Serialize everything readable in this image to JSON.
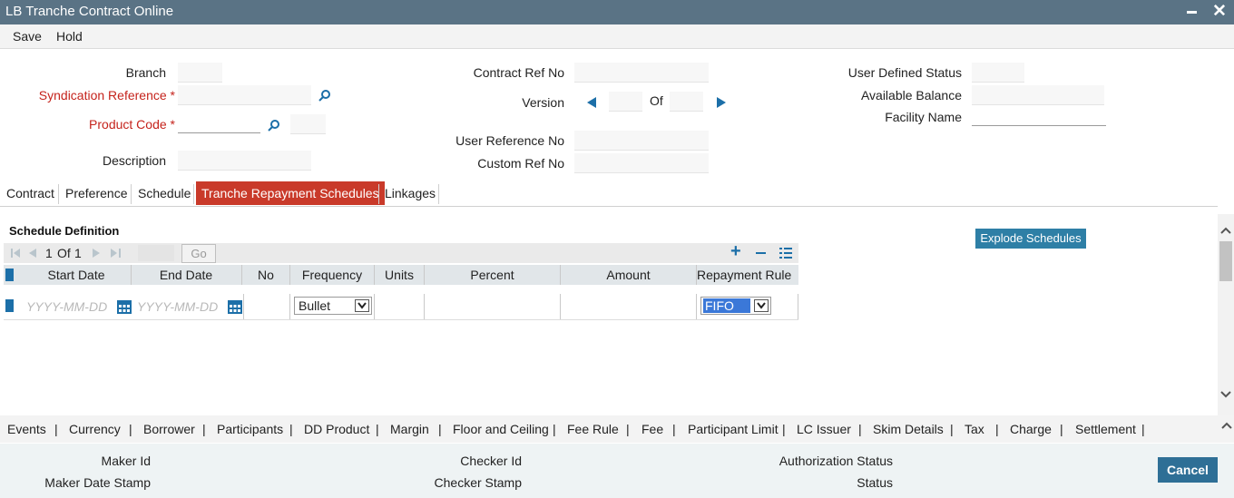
{
  "window": {
    "title": "LB Tranche Contract Online"
  },
  "menu": {
    "save": "Save",
    "hold": "Hold"
  },
  "form": {
    "branch_label": "Branch",
    "syndication_reference_label": "Syndication Reference",
    "product_code_label": "Product Code",
    "description_label": "Description",
    "required_mark": "*",
    "contract_ref_no_label": "Contract Ref No",
    "version_label": "Version",
    "of_label": "Of",
    "user_reference_no_label": "User Reference No",
    "custom_ref_no_label": "Custom Ref No",
    "user_defined_status_label": "User Defined Status",
    "available_balance_label": "Available Balance",
    "facility_name_label": "Facility Name"
  },
  "tabs": [
    "Contract",
    "Preference",
    "Schedule",
    "Tranche Repayment Schedules",
    "Linkages"
  ],
  "active_tab": "Tranche Repayment Schedules",
  "schedule": {
    "title": "Schedule Definition",
    "pagination": {
      "page": "1",
      "of_label": "Of",
      "total": "1",
      "go_label": "Go"
    },
    "columns": [
      "Start Date",
      "End Date",
      "No",
      "Frequency",
      "Units",
      "Percent",
      "Amount",
      "Repayment Rule"
    ],
    "row": {
      "start_date_placeholder": "YYYY-MM-DD",
      "end_date_placeholder": "YYYY-MM-DD",
      "frequency": "Bullet",
      "repayment_rule": "FIFO"
    }
  },
  "explode_button": "Explode Schedules",
  "bottom_nav": [
    "Events",
    "Currency",
    "Borrower",
    "Participants",
    "DD Product",
    "Margin",
    "Floor and Ceiling",
    "Fee Rule",
    "Fee",
    "Participant Limit",
    "LC Issuer",
    "Skim Details",
    "Tax",
    "Charge",
    "Settlement"
  ],
  "bottom_sep": "|",
  "footer": {
    "maker_id": "Maker Id",
    "maker_date_stamp": "Maker Date Stamp",
    "checker_id": "Checker Id",
    "checker_stamp": "Checker Stamp",
    "authorization_status": "Authorization Status",
    "status": "Status"
  },
  "cancel_button": "Cancel",
  "colors": {
    "titlebar": "#5a7385",
    "active_tab": "#c93a2a",
    "button": "#2e7fa6",
    "required": "#c5231c"
  }
}
